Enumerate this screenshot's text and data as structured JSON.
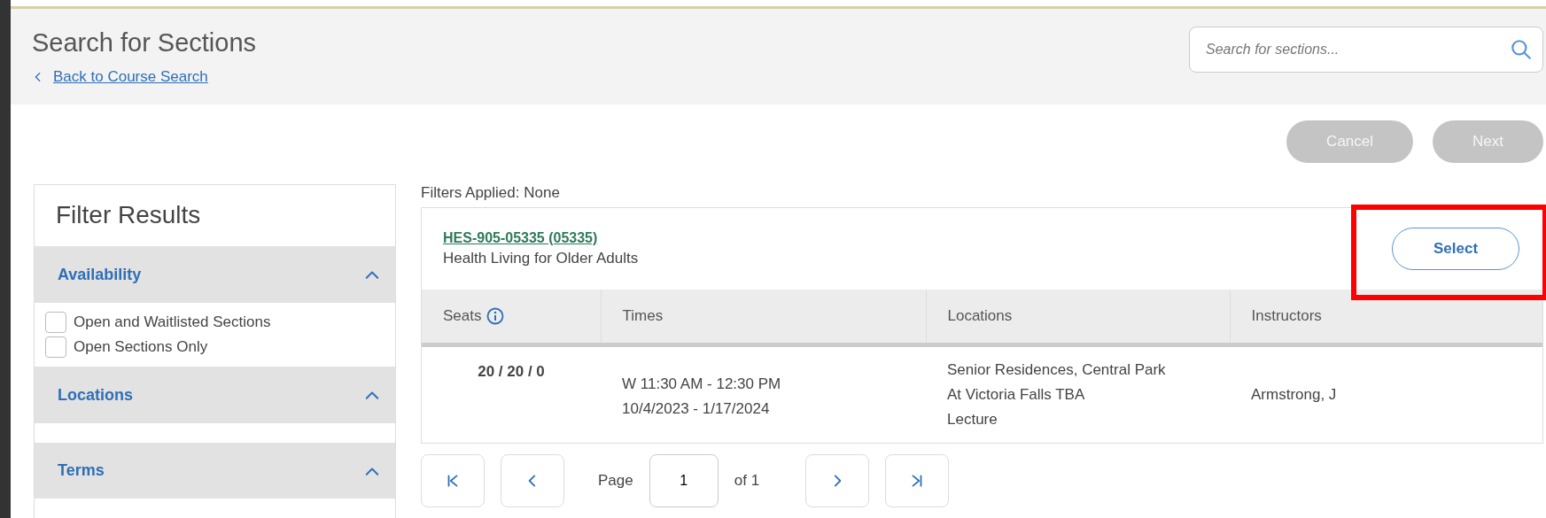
{
  "header": {
    "title": "Search for Sections",
    "back_link": "Back to Course Search",
    "search": {
      "placeholder": "Search for sections..."
    }
  },
  "actions": [
    {
      "label": "Cancel",
      "disabled": true
    },
    {
      "label": "Next",
      "disabled": true
    }
  ],
  "filters": {
    "title": "Filter Results",
    "groups": [
      {
        "label": "Availability",
        "expanded": true,
        "options": [
          {
            "label": "Open and Waitlisted Sections",
            "checked": false
          },
          {
            "label": "Open Sections Only",
            "checked": false
          }
        ]
      },
      {
        "label": "Locations",
        "expanded": true
      },
      {
        "label": "Terms",
        "expanded": true
      }
    ]
  },
  "filters_applied": "Filters Applied: None",
  "section": {
    "code": "HES-905-05335 (05335)",
    "title": "Health Living for Older Adults",
    "select_label": "Select",
    "highlighted": true
  },
  "table": {
    "columns": [
      "Seats",
      "Times",
      "Locations",
      "Instructors"
    ],
    "rows": [
      {
        "seats": "20 / 20 / 0",
        "times": [
          "W 11:30 AM - 12:30 PM",
          "10/4/2023 - 1/17/2024"
        ],
        "locations": [
          "Senior Residences, Central Park",
          "At Victoria Falls TBA",
          "Lecture"
        ],
        "instructors": "Armstrong, J"
      }
    ]
  },
  "pagination": {
    "page_label": "Page",
    "page": "1",
    "of_label": "of",
    "total": "1"
  }
}
